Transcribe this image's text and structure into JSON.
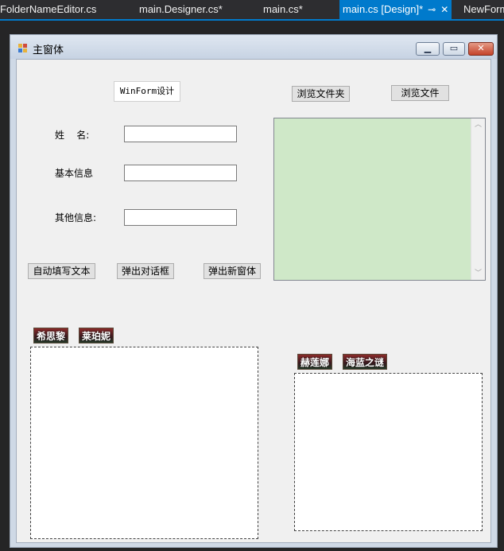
{
  "ide": {
    "tabs": [
      {
        "label": "FolderNameEditor.cs"
      },
      {
        "label": "main.Designer.cs*"
      },
      {
        "label": "main.cs*"
      },
      {
        "label": "main.cs [Design]*"
      },
      {
        "label": "NewForm"
      }
    ],
    "pin_glyph": "⊸",
    "close_glyph": "✕"
  },
  "window": {
    "title": "主窗体",
    "min_glyph": "▁",
    "max_glyph": "▭",
    "close_glyph": "✕"
  },
  "form": {
    "header_button": "WinForm设计",
    "browse_folder_button": "浏览文件夹",
    "browse_file_button": "浏览文件",
    "name_label": "姓    名:",
    "basic_info_label": "基本信息",
    "other_info_label": "其他信息:",
    "name_value": "",
    "basic_info_value": "",
    "other_info_value": "",
    "auto_fill_button": "自动填写文本",
    "popup_dialog_button": "弹出对话框",
    "popup_form_button": "弹出新窗体",
    "left_tags": [
      "希思黎",
      "莱珀妮"
    ],
    "right_tags": [
      "赫莲娜",
      "海蓝之谜"
    ],
    "richbox_color": "#cfe8c8"
  }
}
